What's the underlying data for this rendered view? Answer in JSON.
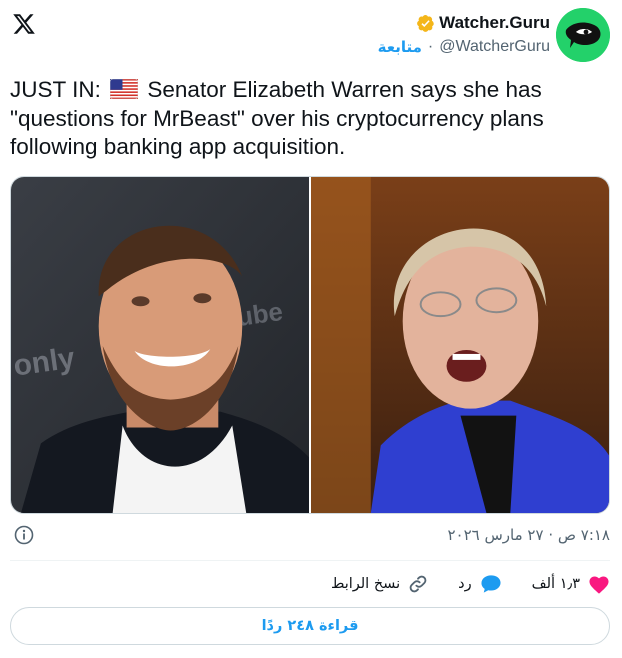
{
  "account": {
    "display_name": "Watcher.Guru",
    "handle": "@WatcherGuru",
    "follow_label": "متابعة",
    "separator": "·",
    "avatar_icon": "watcher-guru-logo-icon",
    "verified_badge_color": "#f4b619"
  },
  "tweet": {
    "prefix": "JUST IN:",
    "flag_icon": "us-flag-icon",
    "text": "Senator Elizabeth Warren says she has \"questions for MrBeast\" over his cryptocurrency plans following banking app acquisition.",
    "images": [
      "mrbeast-photo",
      "elizabeth-warren-photo"
    ],
    "timestamp": "٧:١٨ ص · ٢٧ مارس ٢٠٢٦"
  },
  "actions": {
    "like_count": "١٫٣ ألف",
    "reply_label": "رد",
    "copy_link_label": "نسخ الرابط",
    "read_replies_label": "قراءة ٢٤٨ ردًا"
  },
  "colors": {
    "accent": "#1d9bf0",
    "like": "#f91880",
    "avatar_bg": "#23d16a",
    "muted_text": "#536471"
  }
}
